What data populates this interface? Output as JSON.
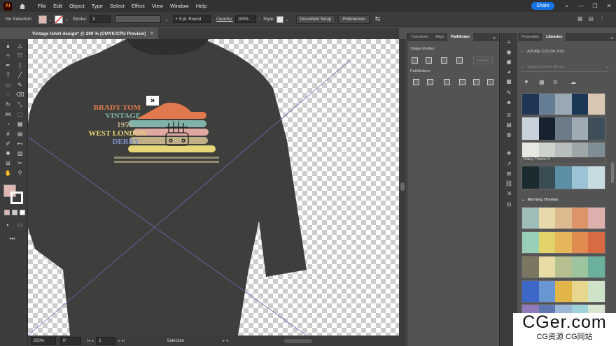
{
  "app": {
    "logo": "Ai",
    "menus": [
      "File",
      "Edit",
      "Object",
      "Type",
      "Select",
      "Effect",
      "View",
      "Window",
      "Help"
    ],
    "share_label": "Share"
  },
  "control": {
    "selection": "No Selection",
    "stroke_label": "Stroke:",
    "brush": "5 pt. Round",
    "opacity_label": "Opacity:",
    "opacity_value": "100%",
    "style_label": "Style:",
    "doc_setup": "Document Setup",
    "preferences": "Preferences"
  },
  "document": {
    "tab_title": "Vintage tshirt design* @ 200 % (CMYK/CPU Preview)"
  },
  "artwork": {
    "lines": [
      "BRADY TOM",
      "VINTAGE",
      "1954",
      "WEST LONDON",
      "DERBY"
    ],
    "colors": {
      "shirt": "#3e3e3c",
      "orange": "#e07a4e",
      "teal": "#7fb3aa",
      "pink": "#dfa8a0",
      "sand": "#bfb088",
      "yellow": "#e6d677",
      "blue": "#7b8fc4",
      "bar": "#8f8a70"
    }
  },
  "status": {
    "zoom": "200%",
    "rotation": "0°",
    "artboard": "1",
    "tool": "Selection"
  },
  "pathfinder_panel": {
    "tabs": [
      "Transform",
      "Align",
      "Pathfinder"
    ],
    "shape_modes": "Shape Modes:",
    "pathfinders": "Pathfinders:",
    "expand": "Expand"
  },
  "libraries": {
    "tabs": [
      "Properties",
      "Libraries"
    ],
    "library_name": "ADOBE COLOR 2021",
    "search_placeholder": "Search current library",
    "theme_label": "Rainy Theme 9",
    "group2_label": "Morning Themes",
    "palettes_rainy": [
      [
        "#1f3553",
        "#657d95",
        "#9aa8b4",
        "#1c3656",
        "#d8c6b2"
      ],
      [
        "#c9d2db",
        "#16232f",
        "#6b7c88",
        "#9eabb3",
        "#3d4e58"
      ],
      [
        "#e8e8e2",
        "#cdd2cc",
        "#b8bebe",
        "#9ea7a8",
        "#7e8e94"
      ],
      [
        "#1b2a2e",
        "#3a4d54",
        "#5c8fa6",
        "#9cc3d5",
        "#c8dbe3"
      ]
    ],
    "palettes_morning": [
      [
        "#9fbcb8",
        "#e7d9a9",
        "#dcb98f",
        "#dc9468",
        "#deb0ad"
      ],
      [
        "#99cfb6",
        "#e2d36b",
        "#e6b65a",
        "#e08b50",
        "#d86b41"
      ],
      [
        "#7b7661",
        "#e7dca5",
        "#b5bf8f",
        "#9ec49f",
        "#6ab09c"
      ],
      [
        "#3d67c8",
        "#6a96d3",
        "#e1b547",
        "#e6d68e",
        "#cfe3c8"
      ],
      [
        "#8f79b8",
        "#5e76b2",
        "#9bb5d4",
        "#9dd2d9",
        "#d6e6d0"
      ]
    ]
  },
  "watermark": {
    "big": "CGer.com",
    "small": "CG资源 CG网站"
  }
}
